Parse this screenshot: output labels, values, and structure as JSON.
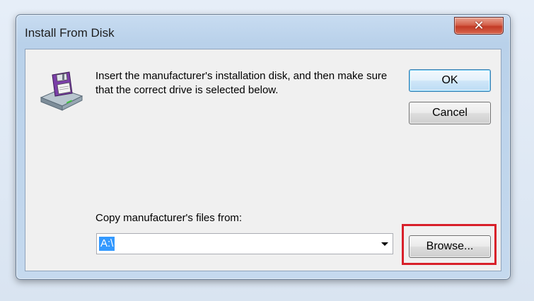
{
  "window": {
    "title": "Install From Disk",
    "close_glyph": "✕"
  },
  "dialog": {
    "message": "Insert the manufacturer's installation disk, and then make sure that the correct drive is selected below.",
    "ok_label": "OK",
    "cancel_label": "Cancel",
    "copy_label": "Copy manufacturer's files from:",
    "copy_value": "A:\\",
    "browse_label": "Browse..."
  },
  "icons": {
    "disk": "floppy-disk-drive-icon",
    "dropdown": "chevron-down-icon",
    "close": "close-icon"
  },
  "colors": {
    "highlight": "#d8202a",
    "selection": "#3399ff",
    "close_button": "#c23b26"
  }
}
